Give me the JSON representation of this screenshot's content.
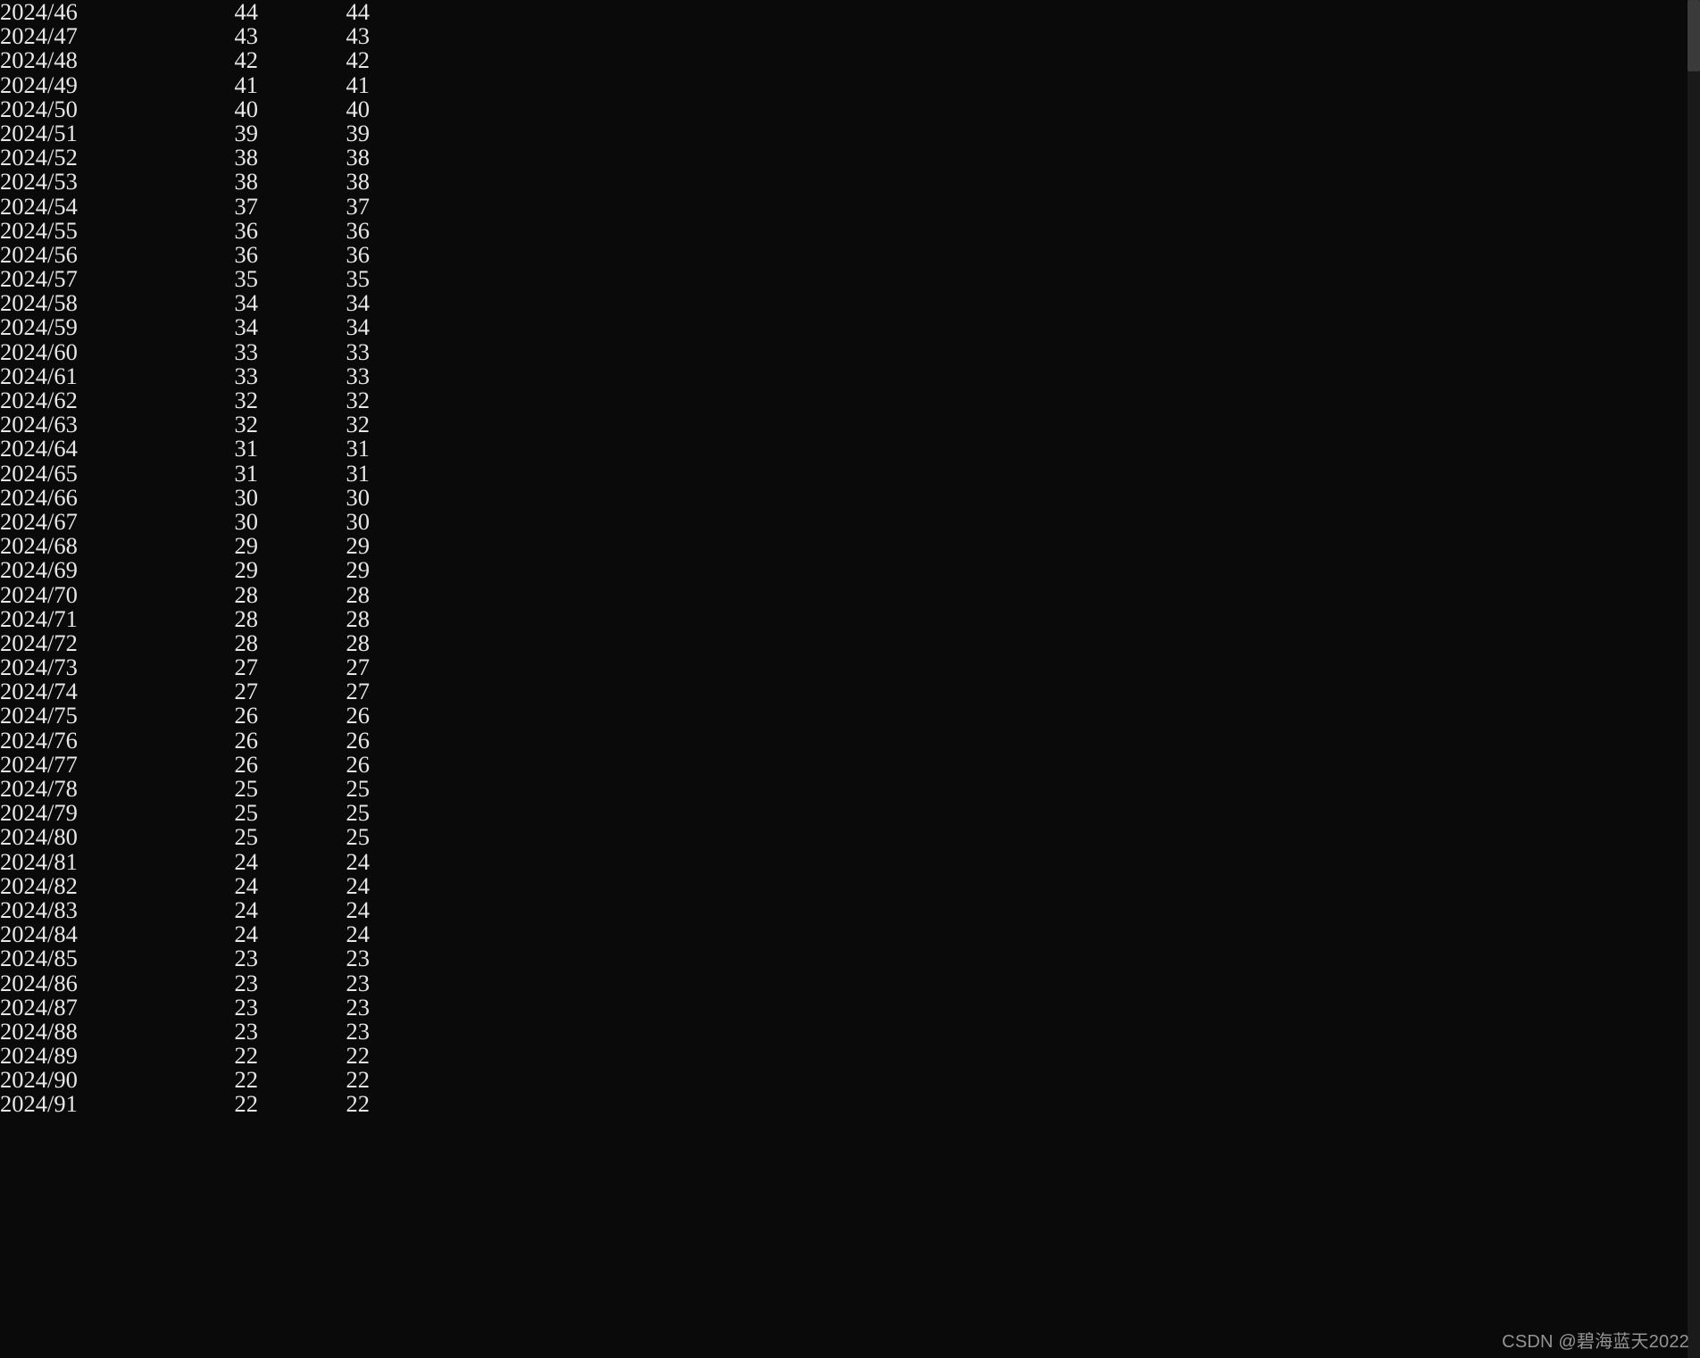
{
  "watermark": "CSDN @碧海蓝天2022",
  "rows": [
    {
      "label": "2024/46",
      "v1": "44",
      "v2": "44"
    },
    {
      "label": "2024/47",
      "v1": "43",
      "v2": "43"
    },
    {
      "label": "2024/48",
      "v1": "42",
      "v2": "42"
    },
    {
      "label": "2024/49",
      "v1": "41",
      "v2": "41"
    },
    {
      "label": "2024/50",
      "v1": "40",
      "v2": "40"
    },
    {
      "label": "2024/51",
      "v1": "39",
      "v2": "39"
    },
    {
      "label": "2024/52",
      "v1": "38",
      "v2": "38"
    },
    {
      "label": "2024/53",
      "v1": "38",
      "v2": "38"
    },
    {
      "label": "2024/54",
      "v1": "37",
      "v2": "37"
    },
    {
      "label": "2024/55",
      "v1": "36",
      "v2": "36"
    },
    {
      "label": "2024/56",
      "v1": "36",
      "v2": "36"
    },
    {
      "label": "2024/57",
      "v1": "35",
      "v2": "35"
    },
    {
      "label": "2024/58",
      "v1": "34",
      "v2": "34"
    },
    {
      "label": "2024/59",
      "v1": "34",
      "v2": "34"
    },
    {
      "label": "2024/60",
      "v1": "33",
      "v2": "33"
    },
    {
      "label": "2024/61",
      "v1": "33",
      "v2": "33"
    },
    {
      "label": "2024/62",
      "v1": "32",
      "v2": "32"
    },
    {
      "label": "2024/63",
      "v1": "32",
      "v2": "32"
    },
    {
      "label": "2024/64",
      "v1": "31",
      "v2": "31"
    },
    {
      "label": "2024/65",
      "v1": "31",
      "v2": "31"
    },
    {
      "label": "2024/66",
      "v1": "30",
      "v2": "30"
    },
    {
      "label": "2024/67",
      "v1": "30",
      "v2": "30"
    },
    {
      "label": "2024/68",
      "v1": "29",
      "v2": "29"
    },
    {
      "label": "2024/69",
      "v1": "29",
      "v2": "29"
    },
    {
      "label": "2024/70",
      "v1": "28",
      "v2": "28"
    },
    {
      "label": "2024/71",
      "v1": "28",
      "v2": "28"
    },
    {
      "label": "2024/72",
      "v1": "28",
      "v2": "28"
    },
    {
      "label": "2024/73",
      "v1": "27",
      "v2": "27"
    },
    {
      "label": "2024/74",
      "v1": "27",
      "v2": "27"
    },
    {
      "label": "2024/75",
      "v1": "26",
      "v2": "26"
    },
    {
      "label": "2024/76",
      "v1": "26",
      "v2": "26"
    },
    {
      "label": "2024/77",
      "v1": "26",
      "v2": "26"
    },
    {
      "label": "2024/78",
      "v1": "25",
      "v2": "25"
    },
    {
      "label": "2024/79",
      "v1": "25",
      "v2": "25"
    },
    {
      "label": "2024/80",
      "v1": "25",
      "v2": "25"
    },
    {
      "label": "2024/81",
      "v1": "24",
      "v2": "24"
    },
    {
      "label": "2024/82",
      "v1": "24",
      "v2": "24"
    },
    {
      "label": "2024/83",
      "v1": "24",
      "v2": "24"
    },
    {
      "label": "2024/84",
      "v1": "24",
      "v2": "24"
    },
    {
      "label": "2024/85",
      "v1": "23",
      "v2": "23"
    },
    {
      "label": "2024/86",
      "v1": "23",
      "v2": "23"
    },
    {
      "label": "2024/87",
      "v1": "23",
      "v2": "23"
    },
    {
      "label": "2024/88",
      "v1": "23",
      "v2": "23"
    },
    {
      "label": "2024/89",
      "v1": "22",
      "v2": "22"
    },
    {
      "label": "2024/90",
      "v1": "22",
      "v2": "22"
    },
    {
      "label": "2024/91",
      "v1": "22",
      "v2": "22"
    }
  ]
}
